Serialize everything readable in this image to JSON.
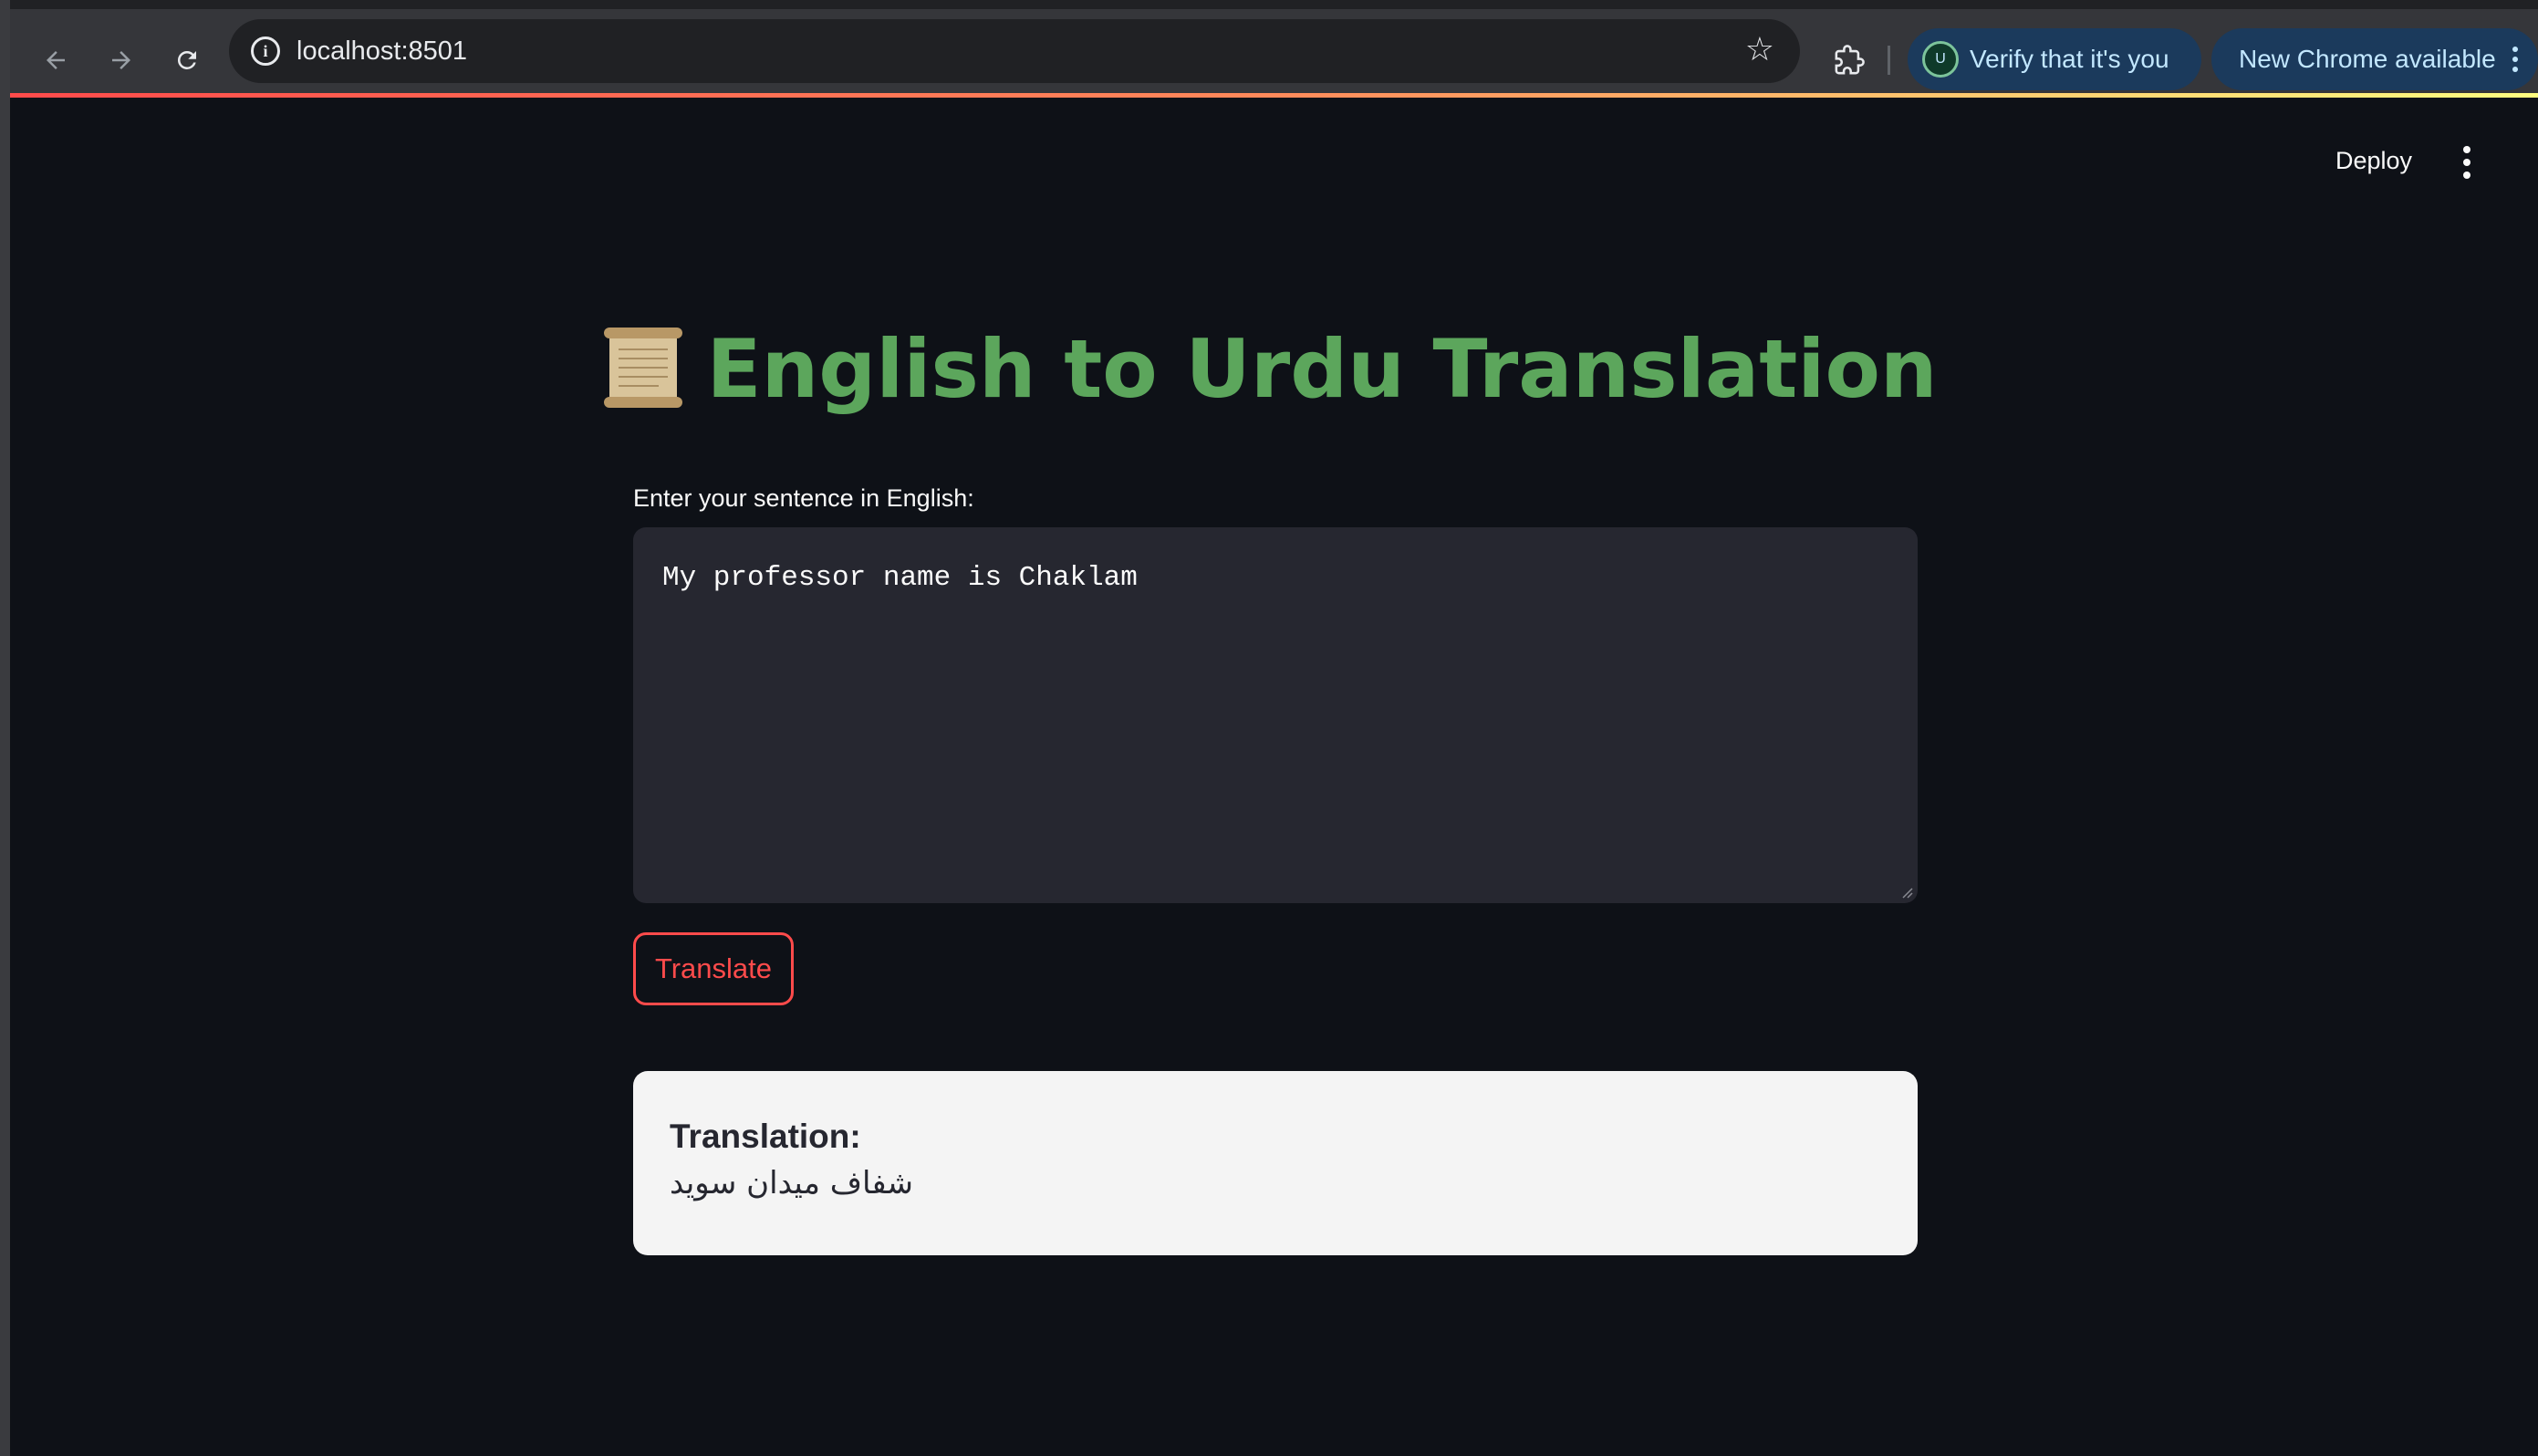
{
  "browser": {
    "url": "localhost:8501",
    "profile_chip": {
      "avatar_letter": "U",
      "label": "Verify that it's you"
    },
    "update_chip": {
      "label": "New Chrome available"
    }
  },
  "app": {
    "header": {
      "deploy_label": "Deploy"
    },
    "title": {
      "icon": "scroll-emoji",
      "text": "English to Urdu Translation"
    },
    "input": {
      "label": "Enter your sentence in English:",
      "value": "My professor name is Chaklam"
    },
    "translate_button": {
      "label": "Translate"
    },
    "result": {
      "heading": "Translation:",
      "text": "شفاف میدان سوید"
    }
  },
  "colors": {
    "title_green": "#5ca65c",
    "button_red": "#ff4b4b",
    "background": "#0e1117",
    "textarea_bg": "#262730",
    "result_bg": "#f4f4f4"
  }
}
